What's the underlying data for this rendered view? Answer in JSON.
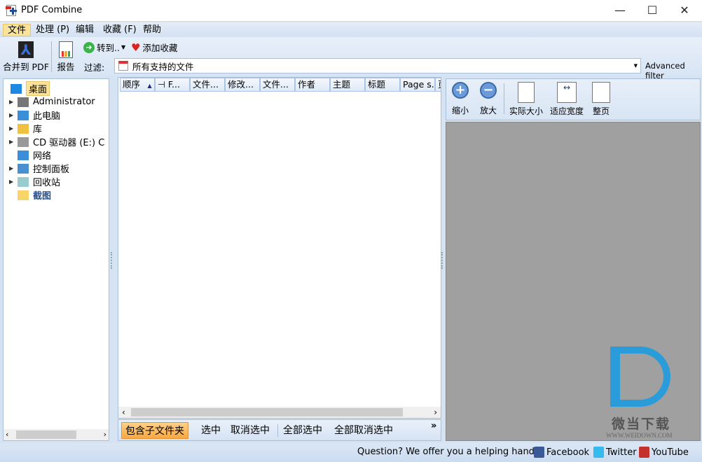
{
  "window": {
    "title": "PDF Combine",
    "minimize": "—",
    "maximize": "☐",
    "close": "✕"
  },
  "menu": [
    {
      "label": "文件",
      "active": true
    },
    {
      "label": "处理 (P)"
    },
    {
      "label": "编辑"
    },
    {
      "label": "收藏 (F)"
    },
    {
      "label": "帮助"
    }
  ],
  "toolbar": {
    "combine": "合并到 PDF",
    "report": "报告",
    "goto": "转到..",
    "add_favorite": "添加收藏",
    "filter_label": "过滤:",
    "filter_value": "所有支持的文件",
    "advanced_filter": "Advanced filter"
  },
  "tree": [
    {
      "label": "桌面",
      "selected": true,
      "icon": "desktop-icon"
    },
    {
      "label": "Administrator",
      "icon": "user-icon",
      "expand": true
    },
    {
      "label": "此电脑",
      "icon": "computer-icon",
      "expand": true
    },
    {
      "label": "库",
      "icon": "library-icon",
      "expand": true
    },
    {
      "label": "CD 驱动器 (E:) C",
      "icon": "cd-drive-icon",
      "expand": true
    },
    {
      "label": "网络",
      "icon": "network-icon",
      "expand": false
    },
    {
      "label": "控制面板",
      "icon": "control-panel-icon",
      "expand": true
    },
    {
      "label": "回收站",
      "icon": "recycle-bin-icon",
      "expand": true
    },
    {
      "label": "截图",
      "icon": "folder-icon",
      "expand": false,
      "bold": true
    }
  ],
  "columns": [
    "顺序",
    "F...",
    "文件...",
    "修改...",
    "文件...",
    "作者",
    "主题",
    "标题",
    "Page s...",
    "页"
  ],
  "file_actions": {
    "include_subfolders": "包含子文件夹",
    "select": "选中",
    "deselect": "取消选中",
    "select_all": "全部选中",
    "deselect_all": "全部取消选中",
    "more": "»"
  },
  "preview": {
    "zoom_out": "缩小",
    "zoom_in": "放大",
    "actual_size": "实际大小",
    "fit_width": "适应宽度",
    "full_page": "整页",
    "background": "#a0a0a0"
  },
  "watermark": {
    "text": "微当下载",
    "url": "WWW.WEIDOWN.COM"
  },
  "status": {
    "help": "Question? We offer you a helping hand -",
    "facebook": "Facebook",
    "twitter": "Twitter",
    "youtube": "YouTube"
  }
}
